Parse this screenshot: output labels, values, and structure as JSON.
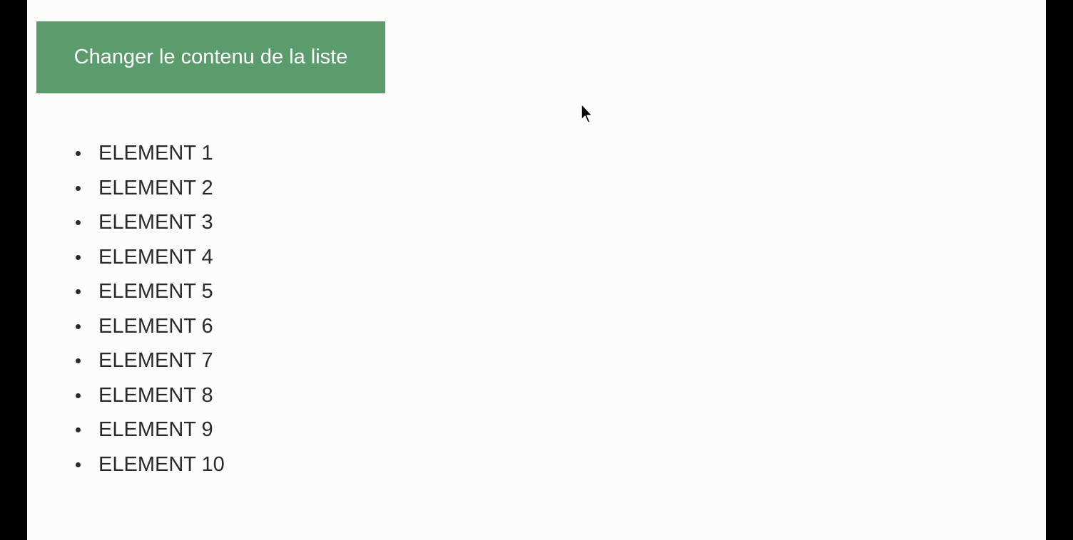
{
  "page": {
    "background": "#fcfcfb",
    "frame_color": "#000000"
  },
  "button": {
    "label": "Changer le contenu de la liste",
    "color": "#5b9c6c",
    "text_color": "#ffffff"
  },
  "list": {
    "items": [
      "ELEMENT 1",
      "ELEMENT 2",
      "ELEMENT 3",
      "ELEMENT 4",
      "ELEMENT 5",
      "ELEMENT 6",
      "ELEMENT 7",
      "ELEMENT 8",
      "ELEMENT 9",
      "ELEMENT 10"
    ]
  },
  "cursor": {
    "icon": "mouse-pointer-icon"
  }
}
